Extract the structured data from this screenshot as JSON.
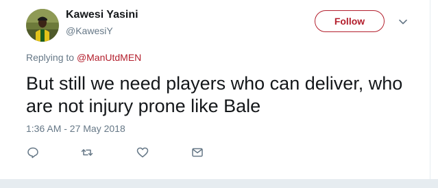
{
  "tweet": {
    "author_name": "Kawesi Yasini",
    "author_handle": "@KawesiY",
    "follow_label": "Follow",
    "replying_prefix": "Replying to ",
    "replying_to": "@ManUtdMEN",
    "text": "But still we need players who can deliver, who are not injury prone like Bale",
    "timestamp": "1:36 AM - 27 May 2018"
  },
  "icons": {
    "more": "chevron-down-icon",
    "reply": "reply-icon",
    "retweet": "retweet-icon",
    "like": "heart-icon",
    "message": "envelope-icon"
  },
  "colors": {
    "accent": "#b31e2c",
    "text": "#14171a",
    "secondary": "#657786",
    "divider": "#e6ecf0",
    "like": "#e0245e"
  }
}
